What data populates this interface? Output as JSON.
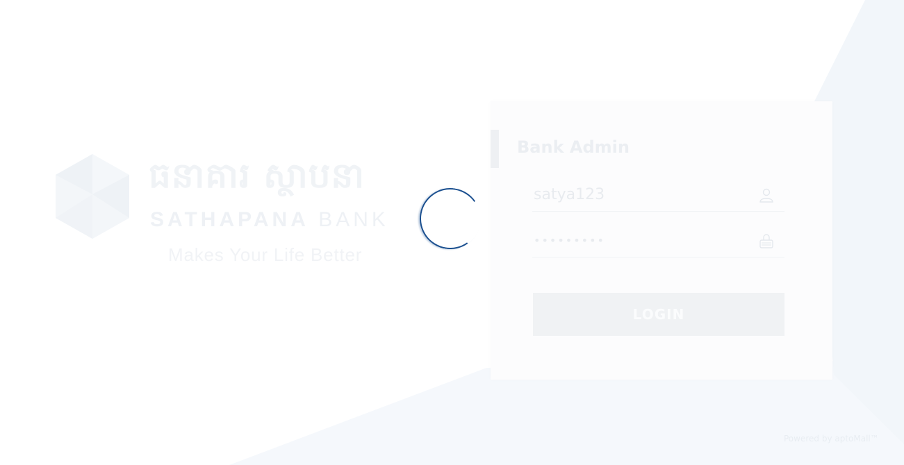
{
  "brand": {
    "khmer_name": "ធនាគារ ស្ថាបនា",
    "name_bold": "SATHAPANA",
    "name_light": "BANK",
    "tagline": "Makes Your Life Better"
  },
  "login_card": {
    "title": "Bank Admin",
    "username": {
      "value": "satya123",
      "icon": "user-icon"
    },
    "password": {
      "value": "•••••••••",
      "icon": "lock-icon"
    },
    "login_label": "LOGIN"
  },
  "footer": {
    "powered_by": "Powered by aptoMall™"
  },
  "loading": {
    "icon": "loading-spinner"
  },
  "colors": {
    "spinner": "#1a4f8f",
    "background_tint": "#f4f7fb"
  }
}
